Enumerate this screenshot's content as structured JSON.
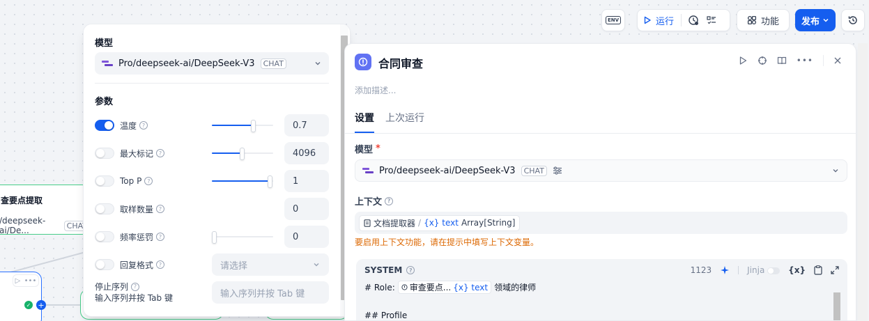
{
  "toolbar": {
    "env_label": "ENV",
    "run_label": "运行",
    "features_label": "功能",
    "publish_label": "发布"
  },
  "canvas": {
    "node_title": "查要点提取",
    "node_model": "/deepseek-ai/De...",
    "node_chip": "CHAT"
  },
  "popup": {
    "model_section": "模型",
    "model_name": "Pro/deepseek-ai/DeepSeek-V3",
    "model_chip": "CHAT",
    "params_section": "参数",
    "params": [
      {
        "label": "温度",
        "enabled": true,
        "value": "0.7",
        "slider_fraction": 0.7
      },
      {
        "label": "最大标记",
        "enabled": false,
        "value": "4096",
        "slider_fraction": 0.5
      },
      {
        "label": "Top P",
        "enabled": false,
        "value": "1",
        "slider_fraction": 1.0
      },
      {
        "label": "取样数量",
        "enabled": false,
        "value": "0"
      },
      {
        "label": "频率惩罚",
        "enabled": false,
        "value": "0",
        "slider_fraction": 0.0
      },
      {
        "label": "回复格式",
        "enabled": false,
        "placeholder": "请选择"
      }
    ],
    "stop_label": "停止序列",
    "stop_hint": "输入序列并按 Tab 键",
    "stop_placeholder": "输入序列并按 Tab 键"
  },
  "panel": {
    "title": "合同审查",
    "description_placeholder": "添加描述...",
    "tabs": [
      "设置",
      "上次运行"
    ],
    "model_label": "模型",
    "required_mark": "*",
    "model_name": "Pro/deepseek-ai/DeepSeek-V3",
    "model_chip": "CHAT",
    "context_label": "上下文",
    "context_node": "文档提取器",
    "context_sep": "/",
    "context_var": "{x} text",
    "context_type": "Array[String]",
    "context_warning": "要启用上下文功能，请在提示中填写上下文变量。",
    "system_label": "SYSTEM",
    "token_count": "1123",
    "jinja_label": "Jinja",
    "var_icon_label": "{x}",
    "prompt_line1_prefix": "# Role:",
    "prompt_line1_node": "审查要点...",
    "prompt_line1_var": "{x} text",
    "prompt_line1_suffix": "领域的律师",
    "prompt_line2": "## Profile"
  },
  "colors": {
    "primary": "#155eef",
    "node_border": "#47cd89",
    "warning": "#dc6803",
    "panel_icon": "#6172f3"
  }
}
